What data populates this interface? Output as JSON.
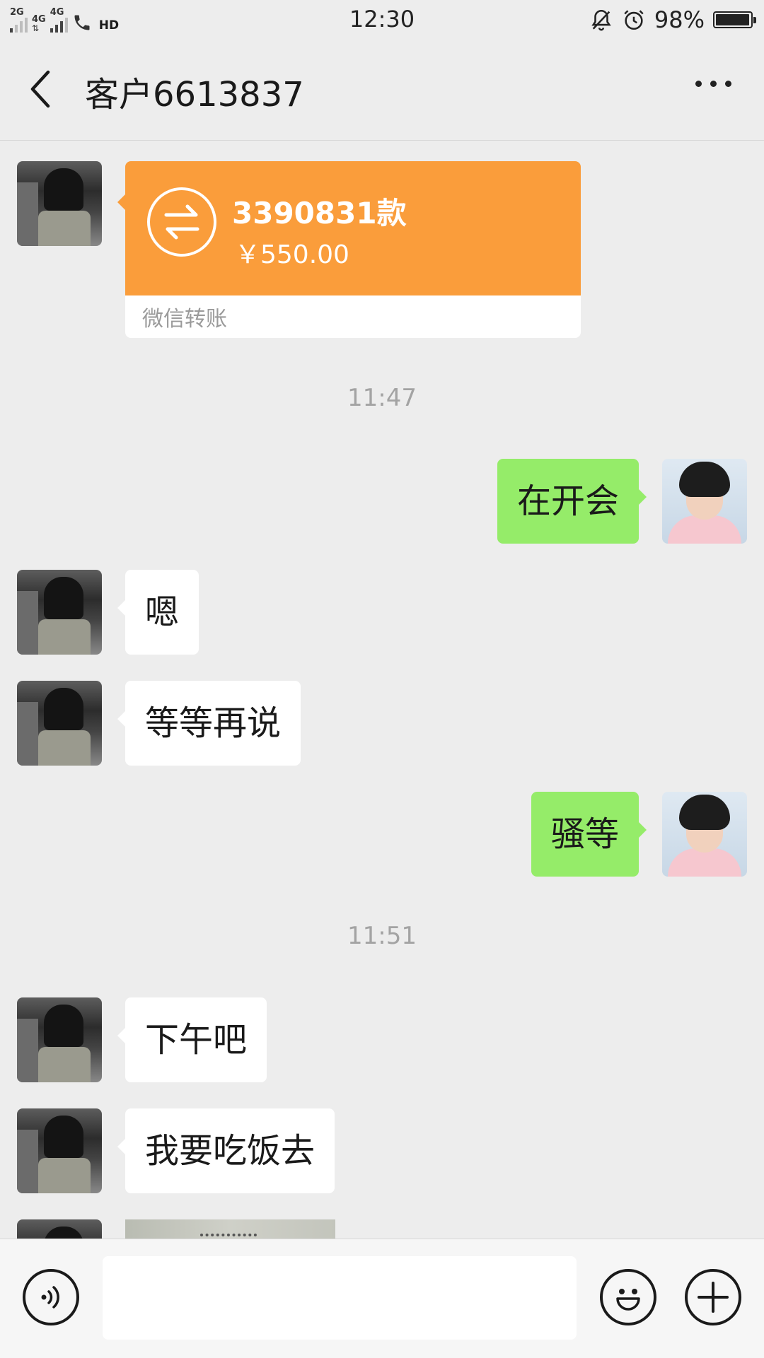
{
  "status_bar": {
    "sim1": "2G",
    "sim2_a": "4G",
    "sim2_b": "4G",
    "hd": "HD",
    "time": "12:30",
    "battery_percent": "98%",
    "battery_level": 0.98
  },
  "header": {
    "title": "客户6613837",
    "back_icon": "chevron-left-icon",
    "menu_icon": "more-dots-icon"
  },
  "messages": {
    "transfer": {
      "title": "3390831款",
      "amount": "￥550.00",
      "label": "微信转账"
    },
    "time1": "11:47",
    "m1": "在开会",
    "m2": "嗯",
    "m3": "等等再说",
    "m4": "骚等",
    "time2": "11:51",
    "m5": "下午吧",
    "m6": "我要吃饭去"
  },
  "input_bar": {
    "voice_icon": "voice-icon",
    "emoji_icon": "emoji-icon",
    "plus_icon": "plus-icon",
    "placeholder": ""
  },
  "colors": {
    "background": "#ededed",
    "bubble_out": "#95ec69",
    "bubble_in": "#ffffff",
    "transfer": "#fa9d3b"
  }
}
